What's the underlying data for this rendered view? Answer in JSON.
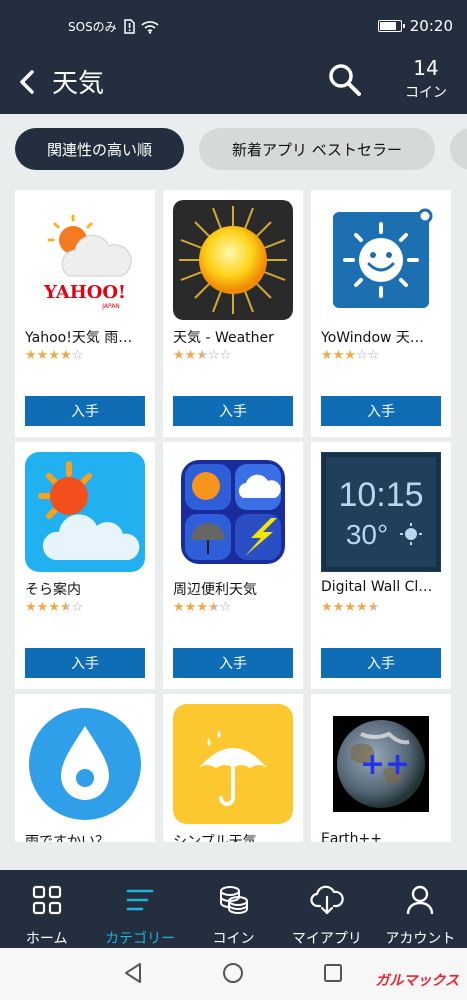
{
  "status_bar": {
    "carrier": "SOSのみ",
    "time": "20:20",
    "battery_level": 0.85
  },
  "header": {
    "title": "天気",
    "coin_count": "14",
    "coin_label": "コイン"
  },
  "filters": [
    {
      "label": "関連性の高い順",
      "selected": true
    },
    {
      "label": "新着アプリ ベストセラー",
      "selected": false
    },
    {
      "label": "",
      "selected": false
    }
  ],
  "apps": [
    {
      "name": "Yahoo!天気 雨…",
      "rating": 4,
      "button": "入手",
      "icon": "yahoo-weather-icon"
    },
    {
      "name": "天気 - Weather",
      "rating": 2.5,
      "button": "入手",
      "icon": "sun-icon"
    },
    {
      "name": "YoWindow 天…",
      "rating": 3,
      "button": "入手",
      "icon": "smiling-sun-icon"
    },
    {
      "name": "そら案内",
      "rating": 3.5,
      "button": "入手",
      "icon": "sun-cloud-icon"
    },
    {
      "name": "周辺便利天気",
      "rating": 3.5,
      "button": "入手",
      "icon": "weather-quadrant-icon"
    },
    {
      "name": "Digital Wall Cl…",
      "rating": 4.5,
      "button": "入手",
      "icon": "digital-clock-icon"
    },
    {
      "name": "雨ですかい？",
      "rating": 0,
      "button": "",
      "icon": "water-drop-icon"
    },
    {
      "name": "シンプル天気",
      "rating": 0,
      "button": "",
      "icon": "umbrella-icon"
    },
    {
      "name": "Earth++",
      "rating": 0,
      "button": "",
      "icon": "earth-icon"
    }
  ],
  "clock_widget": {
    "time": "10:15",
    "temp": "30°"
  },
  "bottom_nav": [
    {
      "label": "ホーム",
      "icon": "grid-icon",
      "active": false
    },
    {
      "label": "カテゴリー",
      "icon": "list-icon",
      "active": true
    },
    {
      "label": "コイン",
      "icon": "coins-icon",
      "active": false
    },
    {
      "label": "マイアプリ",
      "icon": "cloud-download-icon",
      "active": false
    },
    {
      "label": "アカウント",
      "icon": "person-icon",
      "active": false
    }
  ],
  "watermark": "ガルマックス",
  "colors": {
    "header_bg": "#232f3e",
    "accent": "#1fb2e0",
    "button": "#0f6db5",
    "star": "#f3a847"
  }
}
